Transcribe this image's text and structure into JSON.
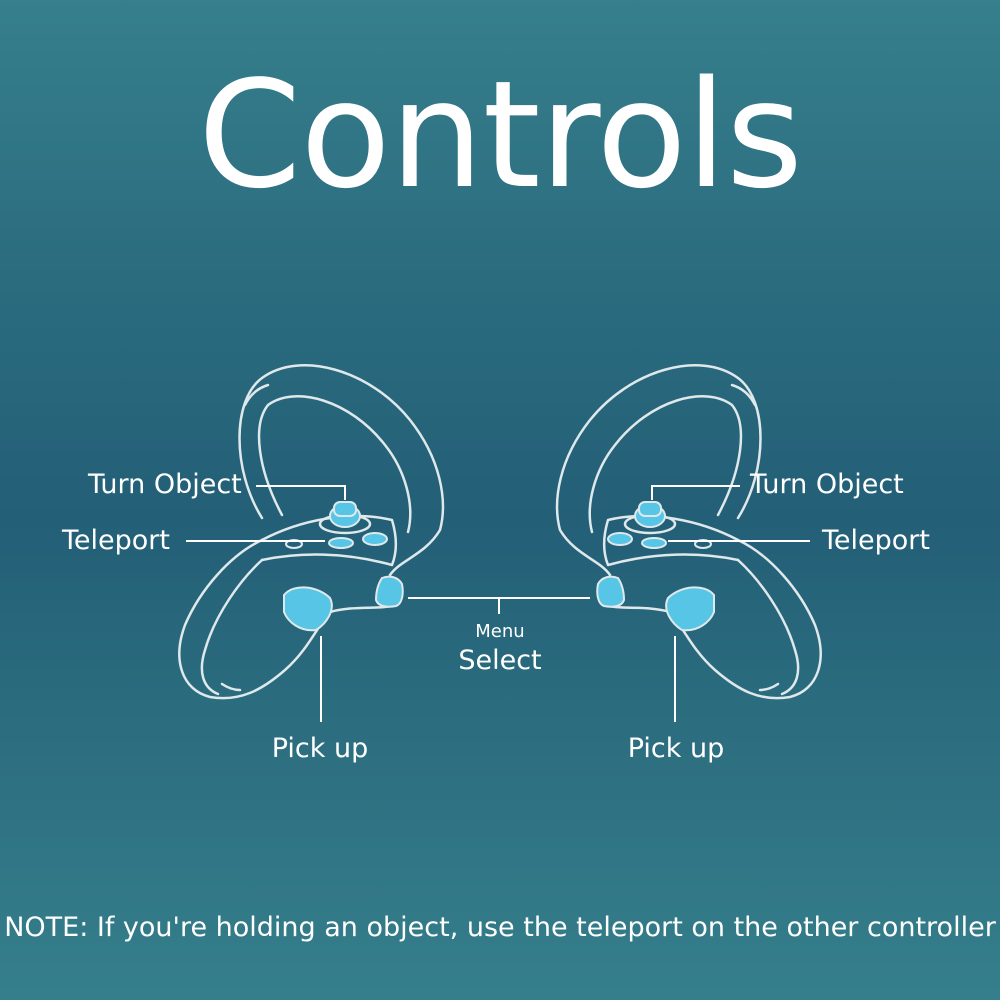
{
  "title": "Controls",
  "labels": {
    "left_turn_object": "Turn Object",
    "left_teleport": "Teleport",
    "right_turn_object": "Turn Object",
    "right_teleport": "Teleport",
    "menu": "Menu",
    "select": "Select",
    "left_pick_up": "Pick up",
    "right_pick_up": "Pick up"
  },
  "note": "NOTE: If you're holding an object, use the teleport on the other controller",
  "colors": {
    "background": "#2b6c7f",
    "outline": "#dfe8ea",
    "highlight": "#56c5e6",
    "text": "#ffffff"
  },
  "icons": [
    "left-controller-icon",
    "right-controller-icon"
  ]
}
